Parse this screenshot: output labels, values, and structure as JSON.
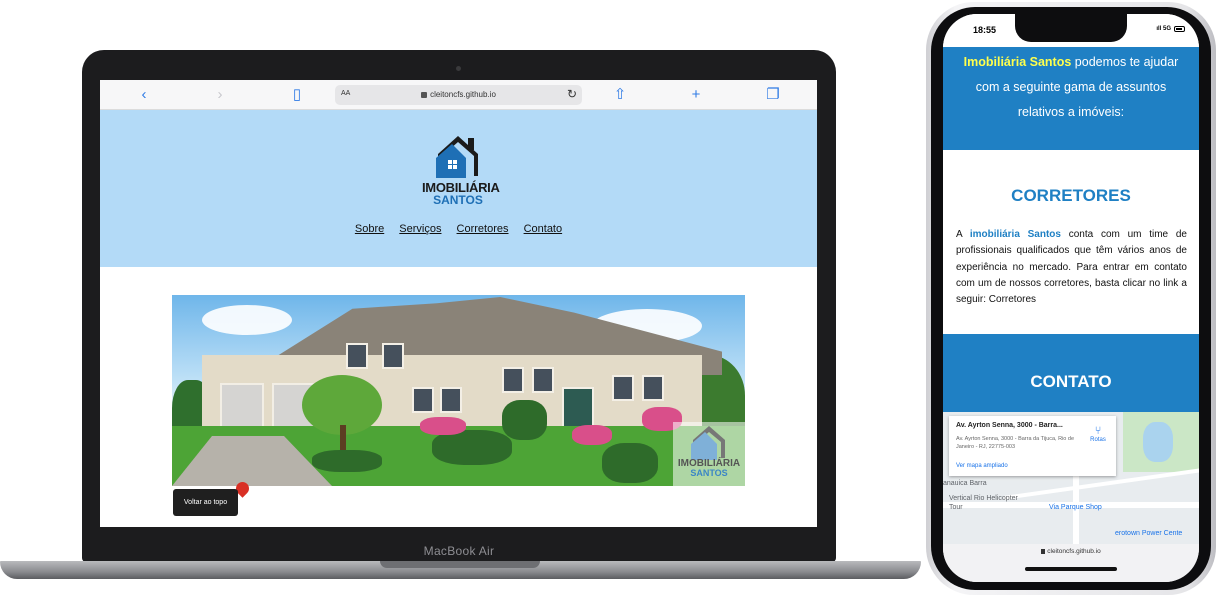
{
  "laptop": {
    "model_label": "MacBook Air",
    "browser": {
      "reader_label": "AA",
      "url": "cleitoncfs.github.io"
    },
    "site": {
      "logo_line1": "IMOBILIÁRIA",
      "logo_line2": "SANTOS",
      "nav": [
        "Sobre",
        "Serviços",
        "Corretores",
        "Contato"
      ],
      "hero_watermark_line1": "IMOBILIÁRIA",
      "hero_watermark_line2": "SANTOS"
    }
  },
  "phone": {
    "status": {
      "time": "18:55",
      "network": "5G"
    },
    "intro": {
      "brand": "Imobiliária Santos",
      "text": "podemos te ajudar com a seguinte gama de assuntos relativos a imóveis:"
    },
    "corretores": {
      "title": "CORRETORES",
      "text_prefix": "A",
      "brand": "imobiliária Santos",
      "text": "conta com um time de profissionais qualificados que têm vários anos de experiência no mercado. Para entrar em contato com um de nossos corretores, basta clicar no link a seguir: Corretores"
    },
    "contato": {
      "title": "CONTATO"
    },
    "map": {
      "card_title": "Av. Ayrton Senna, 3000 - Barra...",
      "card_address": "Av. Ayrton Senna, 3000 - Barra da Tijuca, Rio de Janeiro - RJ, 22775-003",
      "directions_label": "Rotas",
      "larger_map_label": "Ver mapa ampliado",
      "labels": [
        "anauica Barra",
        "Vertical Rio Helicopter Tour",
        "Via Parque Shop",
        "erotown Power Cente"
      ]
    },
    "back_to_top": "Voltar ao topo",
    "url": "cleitoncfs.github.io"
  },
  "colors": {
    "brand_blue": "#1f80c4",
    "header_light_blue": "#b3daf7",
    "highlight_yellow": "#ffff4d"
  }
}
